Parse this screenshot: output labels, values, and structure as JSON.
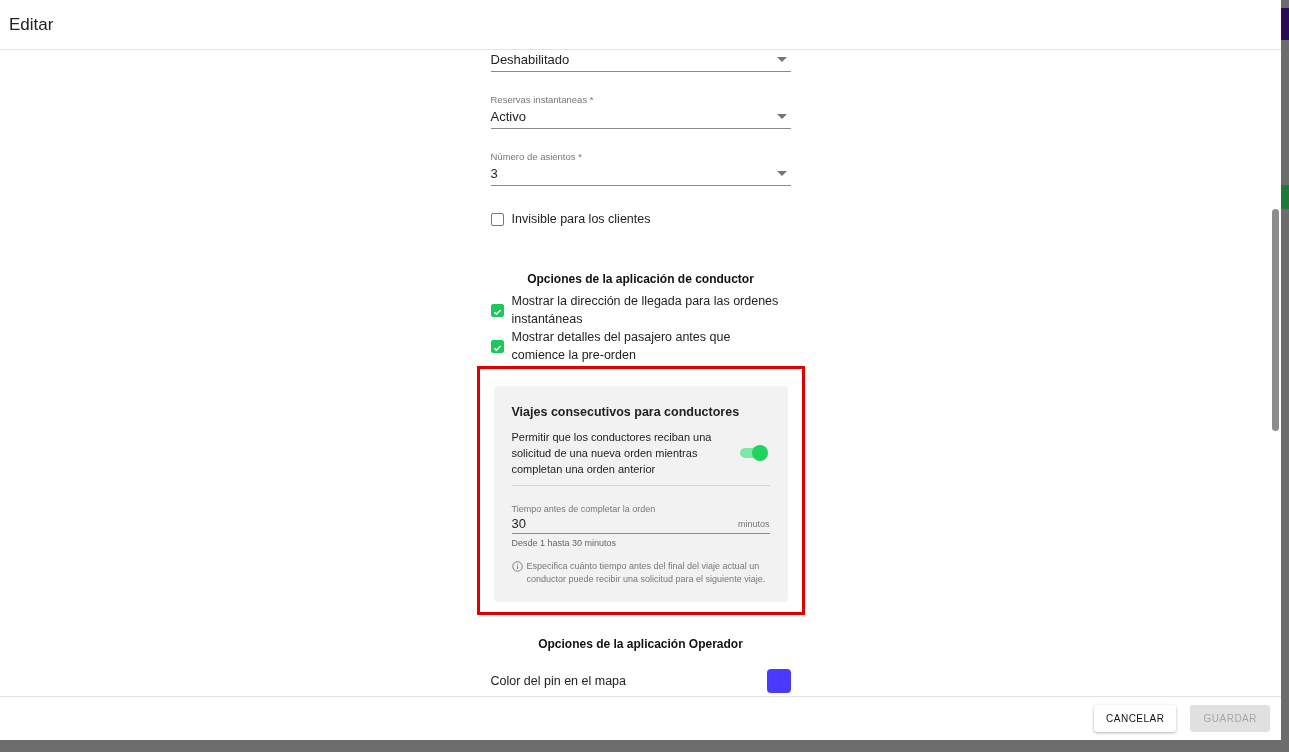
{
  "dialog": {
    "title": "Editar"
  },
  "fields": [
    {
      "value": "Deshabilitado"
    },
    {
      "label": "Reservas instantaneas *",
      "value": "Activo"
    },
    {
      "label": "Número de asientos *",
      "value": "3"
    }
  ],
  "invisible_checkbox": {
    "label": "Invisible para los clientes",
    "checked": false
  },
  "driver_section": {
    "title": "Opciones de la aplicación de conductor",
    "options": [
      {
        "label": "Mostrar la dirección de llegada para las ordenes instantáneas",
        "checked": true
      },
      {
        "label": "Mostrar detalles del pasajero antes que comience la pre-orden",
        "checked": true
      }
    ]
  },
  "consecutive_card": {
    "highlighted": true,
    "title": "Viajes consecutivos para conductores",
    "toggle_label": "Permitir que los conductores reciban una solicitud de una nueva orden mientras completan una orden anterior",
    "on": true,
    "time_label": "Tiempo antes de completar la orden",
    "time_value": "30",
    "time_unit": "minutos",
    "hint": "Desde 1 hasta 30 minutos",
    "info": "Especifica cuánto tiempo antes del final del viaje actual un conductor puede recibir una solicitud para el siguiente viaje."
  },
  "operator_section": {
    "title": "Opciones de la aplicación Operador",
    "pin_label": "Color del pin en el mapa",
    "color": "#4a3aff"
  },
  "buttons": [
    {
      "label": "CANCELAR",
      "disabled": false
    },
    {
      "label": "GUARDAR",
      "disabled": true
    }
  ]
}
